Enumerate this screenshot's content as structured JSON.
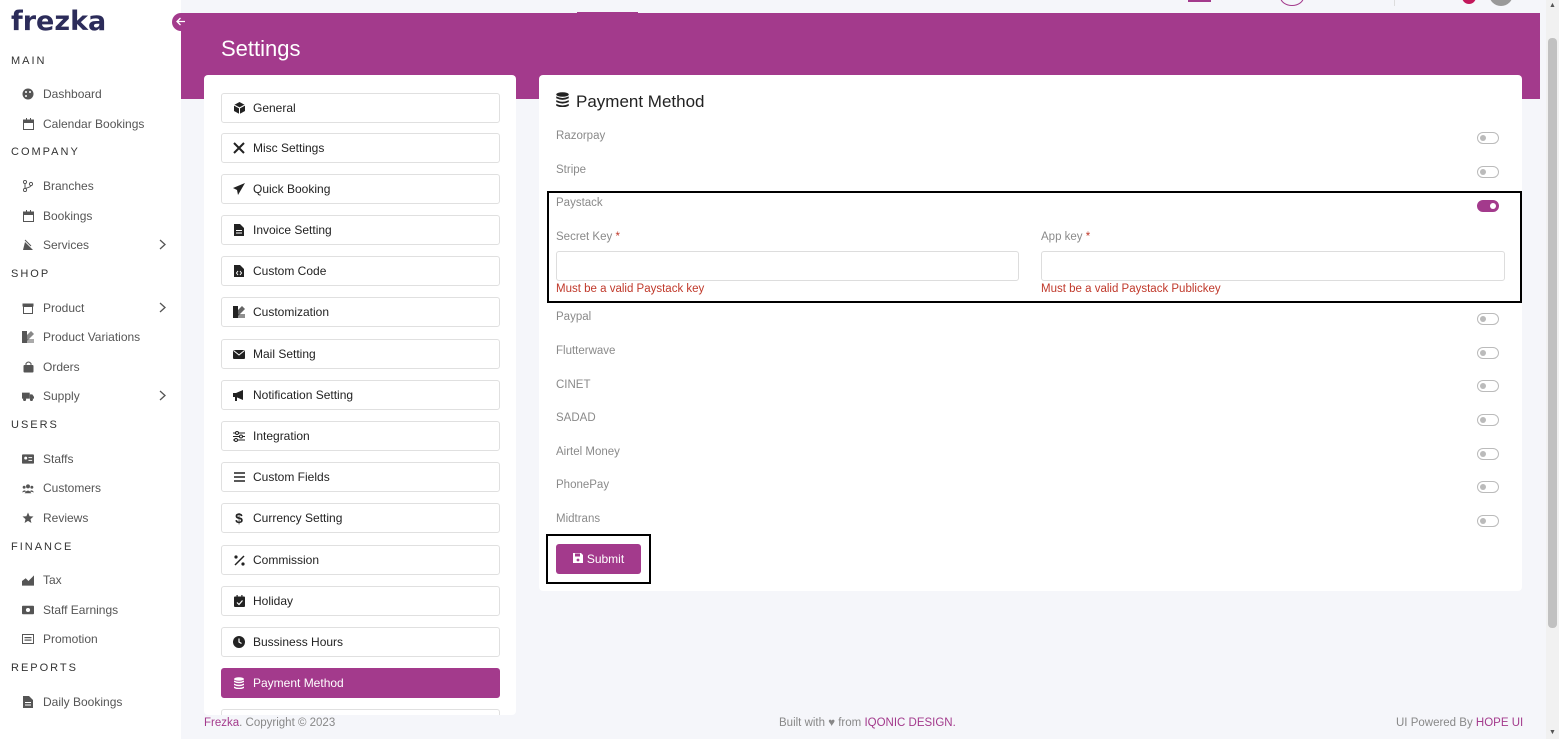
{
  "app": {
    "logo": "frezka"
  },
  "sidebar": {
    "sections": [
      {
        "title": "MAIN"
      },
      {
        "title": "COMPANY"
      },
      {
        "title": "SHOP"
      },
      {
        "title": "USERS"
      },
      {
        "title": "FINANCE"
      },
      {
        "title": "REPORTS"
      }
    ],
    "items": [
      {
        "label": "Dashboard",
        "icon": "palette-icon"
      },
      {
        "label": "Calendar Bookings",
        "icon": "calendar-icon"
      },
      {
        "label": "Branches",
        "icon": "branch-icon"
      },
      {
        "label": "Bookings",
        "icon": "calendar-icon"
      },
      {
        "label": "Services",
        "icon": "services-icon"
      },
      {
        "label": "Product",
        "icon": "box-icon"
      },
      {
        "label": "Product Variations",
        "icon": "variations-icon"
      },
      {
        "label": "Orders",
        "icon": "bag-icon"
      },
      {
        "label": "Supply",
        "icon": "truck-icon"
      },
      {
        "label": "Staffs",
        "icon": "id-card-icon"
      },
      {
        "label": "Customers",
        "icon": "users-icon"
      },
      {
        "label": "Reviews",
        "icon": "star-icon"
      },
      {
        "label": "Tax",
        "icon": "tax-icon"
      },
      {
        "label": "Staff Earnings",
        "icon": "money-icon"
      },
      {
        "label": "Promotion",
        "icon": "promotion-icon"
      },
      {
        "label": "Daily Bookings",
        "icon": "file-icon"
      }
    ]
  },
  "header": {
    "title": "Settings"
  },
  "settings_menu": [
    {
      "label": "General"
    },
    {
      "label": "Misc Settings"
    },
    {
      "label": "Quick Booking"
    },
    {
      "label": "Invoice Setting"
    },
    {
      "label": "Custom Code"
    },
    {
      "label": "Customization"
    },
    {
      "label": "Mail Setting"
    },
    {
      "label": "Notification Setting"
    },
    {
      "label": "Integration"
    },
    {
      "label": "Custom Fields"
    },
    {
      "label": "Currency Setting"
    },
    {
      "label": "Commission"
    },
    {
      "label": "Holiday"
    },
    {
      "label": "Bussiness Hours"
    },
    {
      "label": "Payment Method",
      "active": true
    }
  ],
  "payment": {
    "title": "Payment Method",
    "methods": [
      {
        "label": "Razorpay",
        "enabled": false
      },
      {
        "label": "Stripe",
        "enabled": false
      },
      {
        "label": "Paystack",
        "enabled": true
      },
      {
        "label": "Paypal",
        "enabled": false
      },
      {
        "label": "Flutterwave",
        "enabled": false
      },
      {
        "label": "CINET",
        "enabled": false
      },
      {
        "label": "SADAD",
        "enabled": false
      },
      {
        "label": "Airtel Money",
        "enabled": false
      },
      {
        "label": "PhonePay",
        "enabled": false
      },
      {
        "label": "Midtrans",
        "enabled": false
      }
    ],
    "paystack": {
      "secret_key_label": "Secret Key",
      "app_key_label": "App key",
      "required_mark": "*",
      "secret_key_value": "",
      "app_key_value": "",
      "secret_key_error": "Must be a valid Paystack key",
      "app_key_error": "Must be a valid Paystack Publickey"
    },
    "submit_label": "Submit"
  },
  "footer": {
    "brand": "Frezka",
    "copyright": ". Copyright © 2023",
    "built_with": "Built with ♥ from ",
    "built_brand": "IQONIC DESIGN.",
    "powered": "UI Powered By ",
    "powered_brand": "HOPE UI"
  },
  "colors": {
    "accent": "#a33a8c",
    "error": "#c0392b"
  }
}
